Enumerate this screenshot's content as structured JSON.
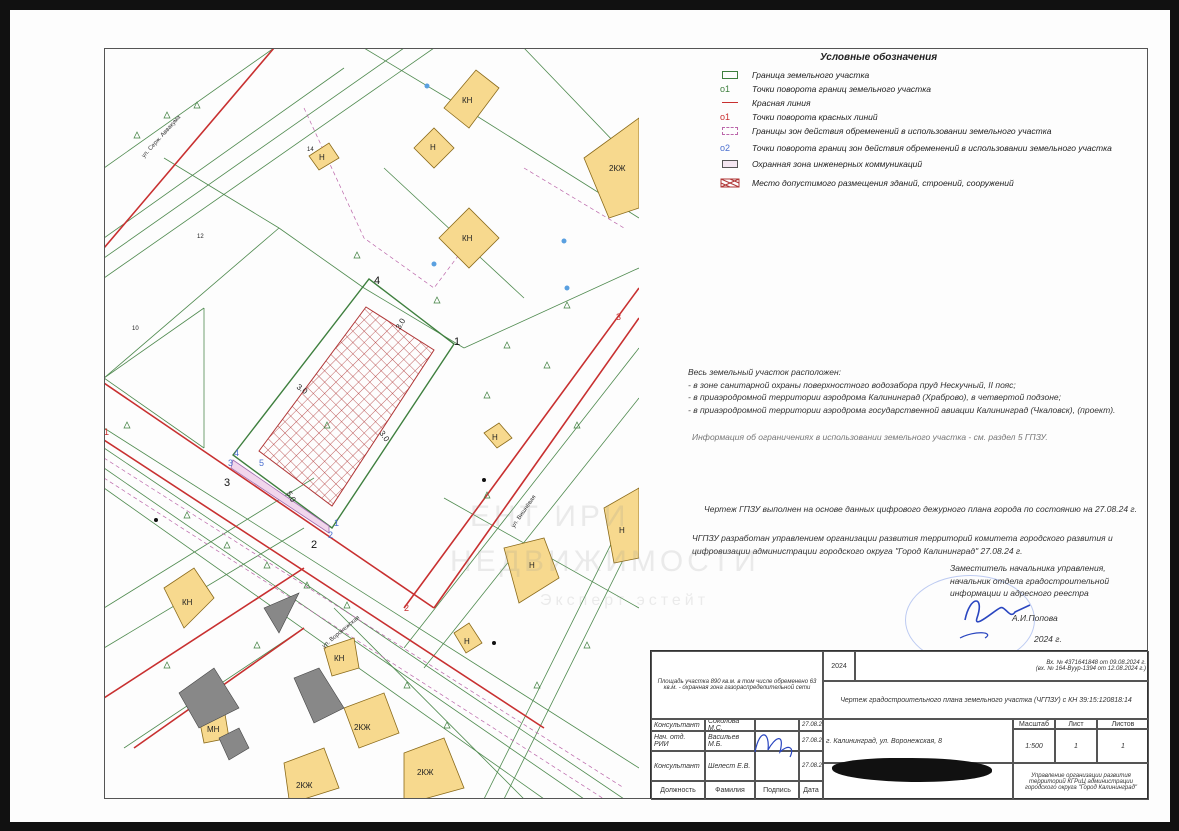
{
  "legend": {
    "title": "Условные обозначения",
    "items": [
      {
        "label": "Граница земельного участка",
        "symbol": "land-boundary",
        "prefix": ""
      },
      {
        "label": "Точки поворота границ земельного участка",
        "symbol": "land-points",
        "prefix": "о1"
      },
      {
        "label": "Красная линия",
        "symbol": "red-line",
        "prefix": ""
      },
      {
        "label": "Точки поворота красных линий",
        "symbol": "red-points",
        "prefix": "о1"
      },
      {
        "label": "Границы зон действия обременений в использовании земельного участка",
        "symbol": "encumbrance",
        "prefix": ""
      },
      {
        "label": "Точки поворота границ зон действия обременений в использовании земельного участка",
        "symbol": "encumbrance-points",
        "prefix": "о2"
      },
      {
        "label": "Охранная зона инженерных коммуникаций",
        "symbol": "protection-zone",
        "prefix": ""
      },
      {
        "label": "Место допустимого размещения зданий, строений, сооружений",
        "symbol": "building-area",
        "prefix": ""
      }
    ]
  },
  "notes": {
    "heading": "Весь земельный участок расположен:",
    "lines": [
      "- в зоне санитарной охраны поверхностного водозабора пруд Нескучный, II пояс;",
      "- в приаэродромной территории аэродрома Калининград (Храброво), в четвертой подзоне;",
      "- в приаэродромной территории аэродрома государственной авиации Калининград (Чкаловск),  (проект)."
    ],
    "info": "Информация об ограничениях в использовании земельного участка - см. раздел 5 ГПЗУ.",
    "made_on": "Чертеж ГПЗУ выполнен на основе данных цифрового дежурного плана города по состоянию на 27.08.24 г.",
    "developed": "ЧГПЗУ разработан управлением организации развития территорий комитета городского развития и цифровизации администрации городского округа \"Город Калининград\" 27.08.24 г."
  },
  "signature": {
    "position": "Заместитель начальника управления, начальник отдела градостроительной информации и адресного реестра",
    "name": "А.И.Попова",
    "year": "2024 г."
  },
  "watermark": {
    "line1": "ЕНТ ИРИ",
    "line2": "НЕДВИЖИМОСТИ",
    "line3": "Эксперт эстейт"
  },
  "map": {
    "labels": {
      "kn1": "КН",
      "n1": "Н",
      "n2": "Н",
      "n14": "14",
      "kzh1": "2КЖ",
      "kn2": "КН",
      "n12": "12",
      "n10": "10",
      "kn3": "КН",
      "n3": "Н",
      "n4": "Н",
      "n5": "Н",
      "n6": "Н",
      "kn4": "КН",
      "mn": "МН",
      "kzh2": "2КЖ",
      "kzh3": "2КЖ",
      "kzh4": "2КЖ"
    },
    "streets": {
      "s1": "ул. Серж. Аввакума",
      "s2": "ул. Воронежская",
      "s3": "ул. Вишнёвая"
    },
    "points": {
      "p1": "1",
      "p2": "2",
      "p3": "3",
      "p4": "4",
      "p5": "5",
      "pb1": "1",
      "pb2": "2",
      "pb3": "3",
      "pb4": "4",
      "pr1": "1",
      "pr2": "2",
      "pr3": "3"
    },
    "dims": {
      "d1": "3.0",
      "d2": "3.0",
      "d3": "3.0",
      "d4": "5.0"
    }
  },
  "title_block": {
    "area_note": "Площадь участка 890 кв.м. в том числе обременено 63 кв.м. - охранная зона газораспределительной сети",
    "year": "2024",
    "reg": "Вх. № 4371641848 от 09.08.2024 г.",
    "reg2": "(вх. № 164-Вуур-1394 от 12.08.2024 г.)",
    "title": "Чертеж градостроительного плана земельного участка (ЧГПЗУ) с КН 39:15:120818:14",
    "address": "г. Калининград, ул. Воронежская, 8",
    "scale_h": "Масштаб",
    "sheet_h": "Лист",
    "sheets_h": "Листов",
    "scale": "1:500",
    "sheet": "1",
    "sheets": "1",
    "org": "Управление организации развития территорий КГРиЦ администрации городского округа \"Город Калининград\"",
    "people": [
      {
        "role": "Консультант",
        "name": "Соколова М.С.",
        "date": "27.08.24"
      },
      {
        "role": "Нач. отд. РИИ",
        "name": "Васильев М.Б.",
        "date": "27.08.24"
      },
      {
        "role": "Консультант",
        "name": "Шелест Е.В.",
        "date": "27.08.24"
      }
    ],
    "headers": {
      "role": "Должность",
      "name": "Фамилия",
      "sign": "Подпись",
      "date": "Дата"
    }
  }
}
